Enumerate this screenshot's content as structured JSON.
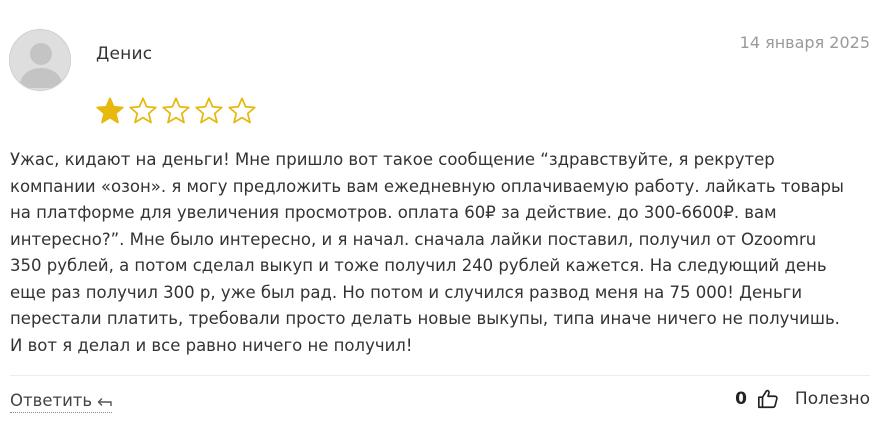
{
  "review": {
    "author": "Денис",
    "date": "14 января 2025",
    "rating": 1,
    "rating_max": 5,
    "text": "Ужас, кидают на деньги! Мне пришло вот такое сообщение “здравствуйте, я рекрутер\nкомпании «озон». я могу предложить вам ежедневную оплачиваемую работу. лайкать товары\nна платформе для увеличения просмотров. оплата 60₽ за действие. до 300-6600₽. вам\nинтересно?”. Мне было интересно, и я начал. сначала лайки поставил, получил от Ozoomru\n350 рублей, а потом сделал выкуп и тоже получил 240 рублей кажется. На следующий день\nеще раз получил 300 р, уже был рад. Но потом и случился развод меня на 75 000! Деньги\nперестали платить, требовали просто делать новые выкупы, типа иначе ничего не получишь.\nИ вот я делал и все равно ничего не получил!",
    "reply_label": "Ответить",
    "reply_icon": "reply-arrow-icon",
    "likes_count": "0",
    "like_icon": "thumbs-up-icon",
    "useful_label": "Полезно"
  },
  "colors": {
    "star_filled": "#e8b80f",
    "star_outline": "#e8b80f",
    "date": "#9a9a9a",
    "text": "#333333",
    "avatar_bg": "#dedede",
    "avatar_figure": "#c4c4c4"
  }
}
